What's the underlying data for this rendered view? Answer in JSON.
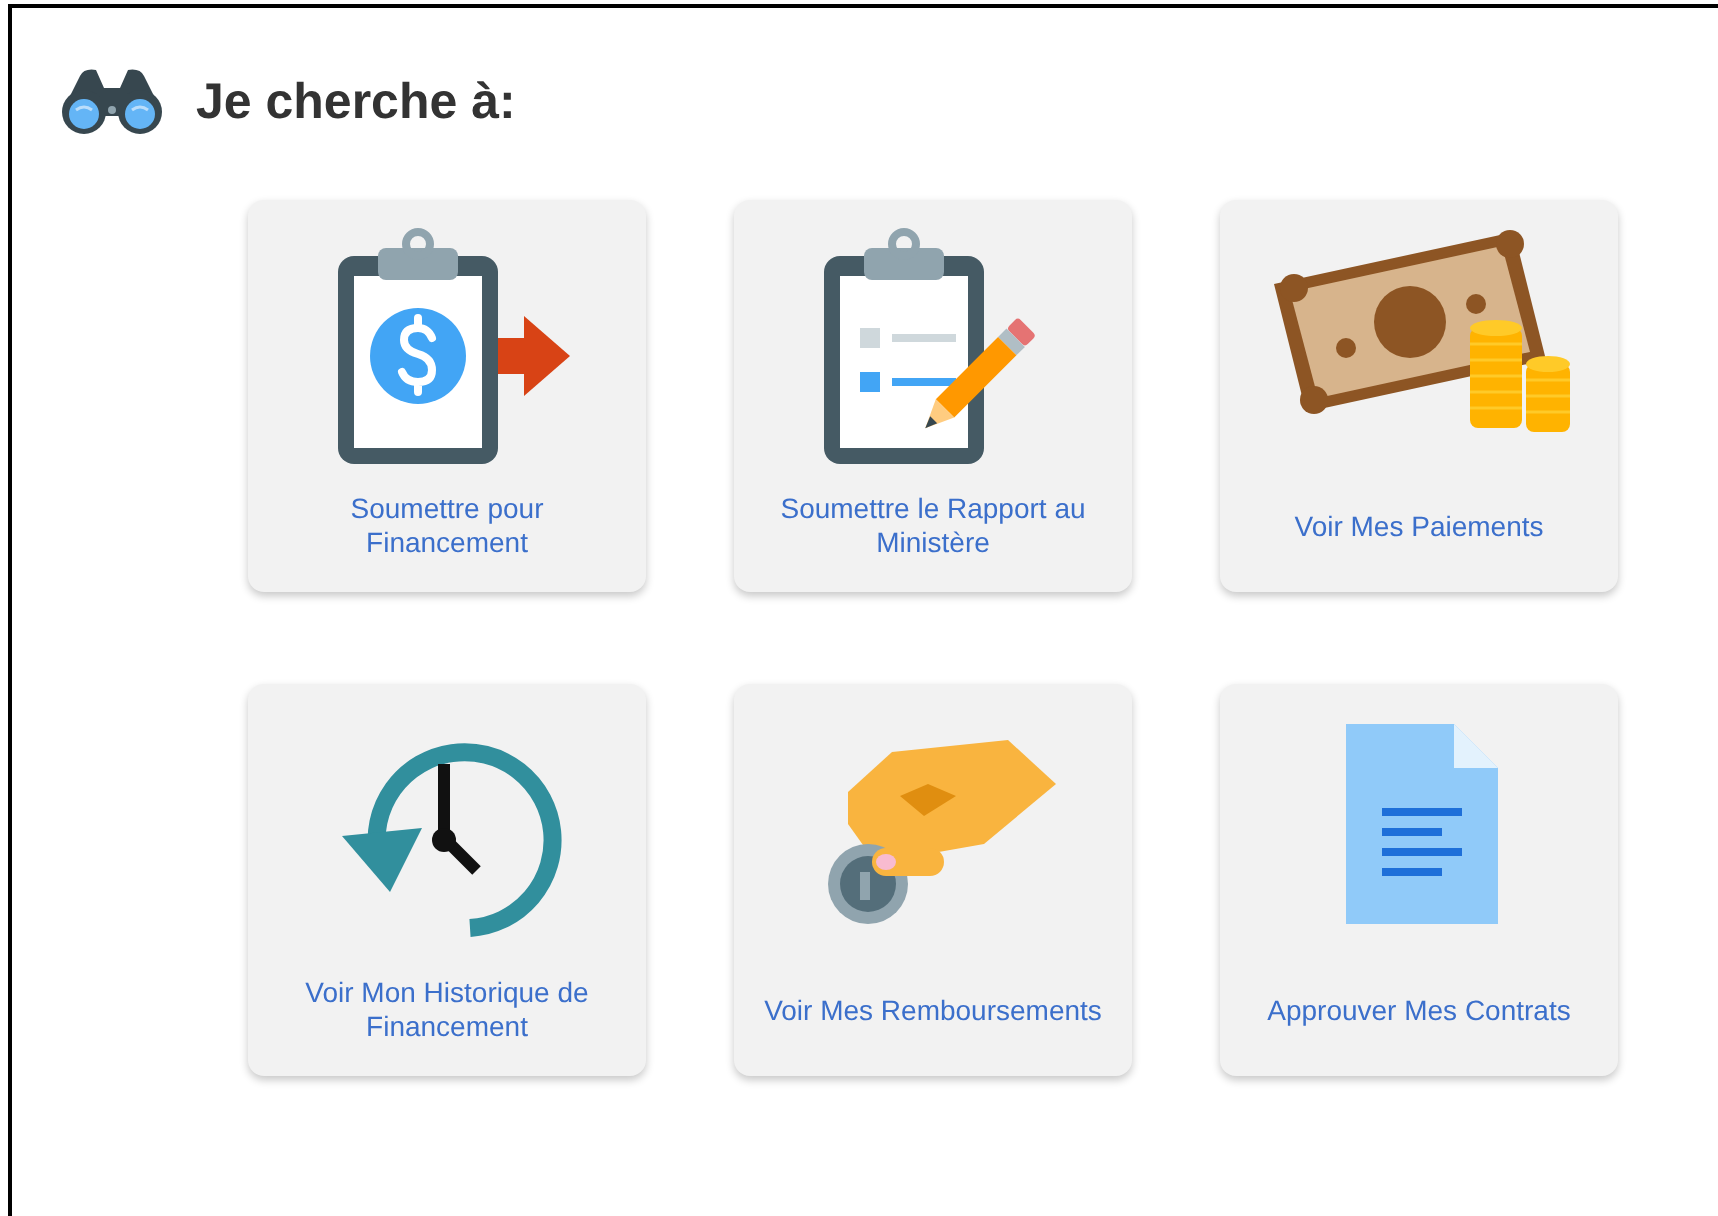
{
  "header": {
    "title": "Je cherche à:"
  },
  "options": [
    {
      "kind": "clipboard-dollar",
      "label": "Soumettre pour Financement"
    },
    {
      "kind": "clipboard-edit",
      "label": "Soumettre le Rapport au Ministère"
    },
    {
      "kind": "money",
      "label": "Voir Mes Paiements"
    },
    {
      "kind": "history",
      "label": "Voir Mon Historique de Financement"
    },
    {
      "kind": "coin-hand",
      "label": "Voir Mes Remboursements"
    },
    {
      "kind": "document",
      "label": "Approuver Mes Contrats"
    }
  ]
}
